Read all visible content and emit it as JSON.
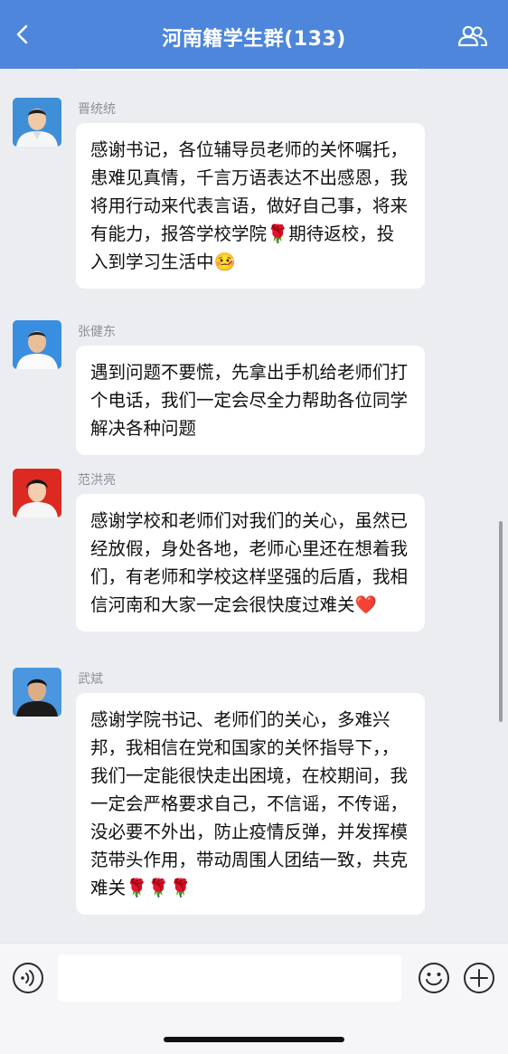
{
  "header": {
    "title": "河南籍学生群(133)",
    "back_icon": "chevron-left-icon",
    "members_icon": "group-members-icon",
    "bg_color": "#4d86db"
  },
  "messages": [
    {
      "sender": "晋统统",
      "text": "感谢书记，各位辅导员老师的关怀嘱托，患难见真情，千言万语表达不出感恩，我将用行动来代表言语，做好自己事，将来有能力，报答学校学院🌹期待返校，投入到学习生活中🤒"
    },
    {
      "sender": "张健东",
      "text": "遇到问题不要慌，先拿出手机给老师们打个电话，我们一定会尽全力帮助各位同学解决各种问题"
    },
    {
      "sender": "范洪亮",
      "text": "感谢学校和老师们对我们的关心，虽然已经放假，身处各地，老师心里还在想着我们，有老师和学校这样坚强的后盾，我相信河南和大家一定会很快度过难关❤️"
    },
    {
      "sender": "武斌",
      "text": "感谢学院书记、老师们的关心，多难兴邦，我相信在党和国家的关怀指导下，，我们一定能很快走出困境，在校期间，我一定会严格要求自己，不信谣，不传谣，没必要不外出，防止疫情反弹，并发挥模范带头作用，带动周围人团结一致，共克难关🌹🌹🌹"
    }
  ],
  "input": {
    "voice_icon": "voice-icon",
    "emoji_icon": "emoji-icon",
    "plus_icon": "plus-icon",
    "value": "",
    "placeholder": ""
  }
}
